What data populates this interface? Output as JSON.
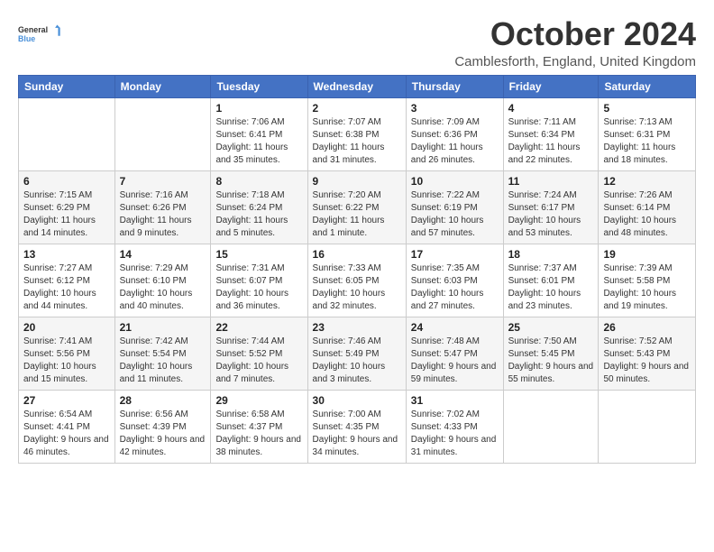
{
  "logo": {
    "line1": "General",
    "line2": "Blue"
  },
  "title": "October 2024",
  "subtitle": "Camblesforth, England, United Kingdom",
  "days_header": [
    "Sunday",
    "Monday",
    "Tuesday",
    "Wednesday",
    "Thursday",
    "Friday",
    "Saturday"
  ],
  "weeks": [
    [
      {
        "day": "",
        "info": ""
      },
      {
        "day": "",
        "info": ""
      },
      {
        "day": "1",
        "info": "Sunrise: 7:06 AM\nSunset: 6:41 PM\nDaylight: 11 hours and 35 minutes."
      },
      {
        "day": "2",
        "info": "Sunrise: 7:07 AM\nSunset: 6:38 PM\nDaylight: 11 hours and 31 minutes."
      },
      {
        "day": "3",
        "info": "Sunrise: 7:09 AM\nSunset: 6:36 PM\nDaylight: 11 hours and 26 minutes."
      },
      {
        "day": "4",
        "info": "Sunrise: 7:11 AM\nSunset: 6:34 PM\nDaylight: 11 hours and 22 minutes."
      },
      {
        "day": "5",
        "info": "Sunrise: 7:13 AM\nSunset: 6:31 PM\nDaylight: 11 hours and 18 minutes."
      }
    ],
    [
      {
        "day": "6",
        "info": "Sunrise: 7:15 AM\nSunset: 6:29 PM\nDaylight: 11 hours and 14 minutes."
      },
      {
        "day": "7",
        "info": "Sunrise: 7:16 AM\nSunset: 6:26 PM\nDaylight: 11 hours and 9 minutes."
      },
      {
        "day": "8",
        "info": "Sunrise: 7:18 AM\nSunset: 6:24 PM\nDaylight: 11 hours and 5 minutes."
      },
      {
        "day": "9",
        "info": "Sunrise: 7:20 AM\nSunset: 6:22 PM\nDaylight: 11 hours and 1 minute."
      },
      {
        "day": "10",
        "info": "Sunrise: 7:22 AM\nSunset: 6:19 PM\nDaylight: 10 hours and 57 minutes."
      },
      {
        "day": "11",
        "info": "Sunrise: 7:24 AM\nSunset: 6:17 PM\nDaylight: 10 hours and 53 minutes."
      },
      {
        "day": "12",
        "info": "Sunrise: 7:26 AM\nSunset: 6:14 PM\nDaylight: 10 hours and 48 minutes."
      }
    ],
    [
      {
        "day": "13",
        "info": "Sunrise: 7:27 AM\nSunset: 6:12 PM\nDaylight: 10 hours and 44 minutes."
      },
      {
        "day": "14",
        "info": "Sunrise: 7:29 AM\nSunset: 6:10 PM\nDaylight: 10 hours and 40 minutes."
      },
      {
        "day": "15",
        "info": "Sunrise: 7:31 AM\nSunset: 6:07 PM\nDaylight: 10 hours and 36 minutes."
      },
      {
        "day": "16",
        "info": "Sunrise: 7:33 AM\nSunset: 6:05 PM\nDaylight: 10 hours and 32 minutes."
      },
      {
        "day": "17",
        "info": "Sunrise: 7:35 AM\nSunset: 6:03 PM\nDaylight: 10 hours and 27 minutes."
      },
      {
        "day": "18",
        "info": "Sunrise: 7:37 AM\nSunset: 6:01 PM\nDaylight: 10 hours and 23 minutes."
      },
      {
        "day": "19",
        "info": "Sunrise: 7:39 AM\nSunset: 5:58 PM\nDaylight: 10 hours and 19 minutes."
      }
    ],
    [
      {
        "day": "20",
        "info": "Sunrise: 7:41 AM\nSunset: 5:56 PM\nDaylight: 10 hours and 15 minutes."
      },
      {
        "day": "21",
        "info": "Sunrise: 7:42 AM\nSunset: 5:54 PM\nDaylight: 10 hours and 11 minutes."
      },
      {
        "day": "22",
        "info": "Sunrise: 7:44 AM\nSunset: 5:52 PM\nDaylight: 10 hours and 7 minutes."
      },
      {
        "day": "23",
        "info": "Sunrise: 7:46 AM\nSunset: 5:49 PM\nDaylight: 10 hours and 3 minutes."
      },
      {
        "day": "24",
        "info": "Sunrise: 7:48 AM\nSunset: 5:47 PM\nDaylight: 9 hours and 59 minutes."
      },
      {
        "day": "25",
        "info": "Sunrise: 7:50 AM\nSunset: 5:45 PM\nDaylight: 9 hours and 55 minutes."
      },
      {
        "day": "26",
        "info": "Sunrise: 7:52 AM\nSunset: 5:43 PM\nDaylight: 9 hours and 50 minutes."
      }
    ],
    [
      {
        "day": "27",
        "info": "Sunrise: 6:54 AM\nSunset: 4:41 PM\nDaylight: 9 hours and 46 minutes."
      },
      {
        "day": "28",
        "info": "Sunrise: 6:56 AM\nSunset: 4:39 PM\nDaylight: 9 hours and 42 minutes."
      },
      {
        "day": "29",
        "info": "Sunrise: 6:58 AM\nSunset: 4:37 PM\nDaylight: 9 hours and 38 minutes."
      },
      {
        "day": "30",
        "info": "Sunrise: 7:00 AM\nSunset: 4:35 PM\nDaylight: 9 hours and 34 minutes."
      },
      {
        "day": "31",
        "info": "Sunrise: 7:02 AM\nSunset: 4:33 PM\nDaylight: 9 hours and 31 minutes."
      },
      {
        "day": "",
        "info": ""
      },
      {
        "day": "",
        "info": ""
      }
    ]
  ]
}
